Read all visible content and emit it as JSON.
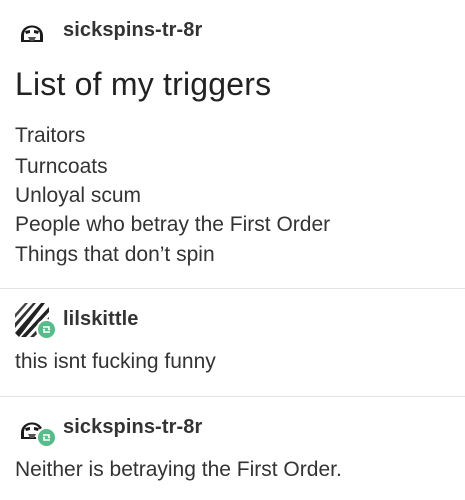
{
  "post1": {
    "username": "sickspins-tr-8r",
    "avatar_icon": "stormtrooper-helmet-icon",
    "title": "List of my triggers",
    "lines": [
      "Traitors",
      "Turncoats",
      "Unloyal scum",
      "People who betray the First Order",
      "Things that don’t spin"
    ]
  },
  "post2": {
    "username": "lilskittle",
    "avatar_icon": "zebra-pattern-icon",
    "badge_icon": "reblog-icon",
    "text": "this isnt fucking funny"
  },
  "post3": {
    "username": "sickspins-tr-8r",
    "avatar_icon": "stormtrooper-helmet-icon",
    "badge_icon": "reblog-icon",
    "text": "Neither is betraying the First Order."
  },
  "colors": {
    "reblog_badge": "#56bc8a",
    "divider": "#e3e3e3"
  }
}
